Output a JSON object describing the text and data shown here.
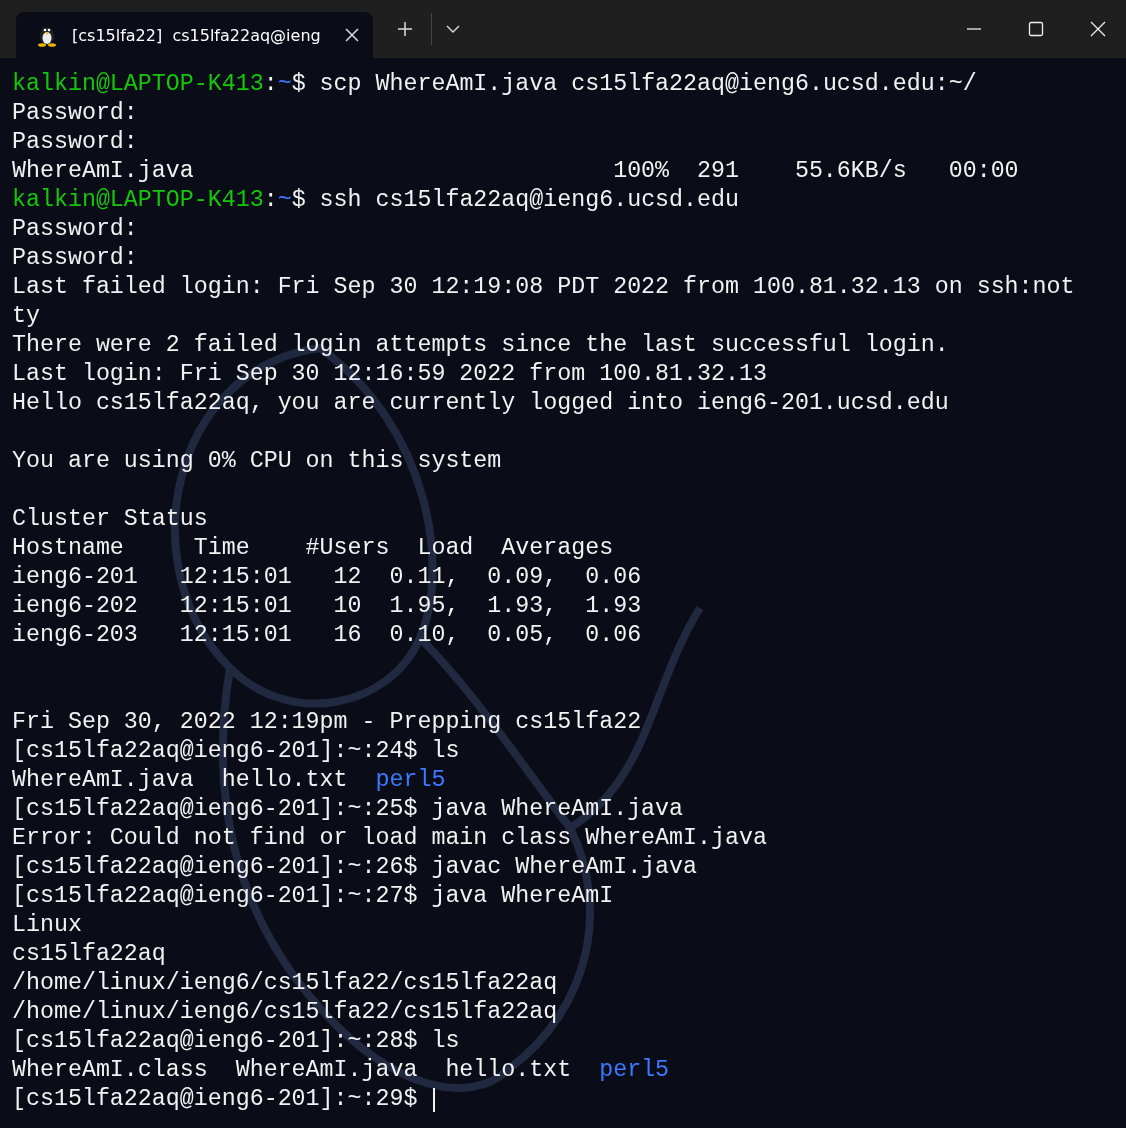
{
  "window": {
    "tabs": [
      {
        "title": "[cs15lfa22]  cs15lfa22aq@ieng",
        "selected": true
      }
    ]
  },
  "terminal": {
    "lines": [
      {
        "kind": "text",
        "segments": [
          {
            "kind": "user",
            "text": "kalkin@LAPTOP-K413"
          },
          {
            "kind": "plain",
            "text": ":"
          },
          {
            "kind": "path",
            "text": "~"
          },
          {
            "kind": "plain",
            "text": "$ scp WhereAmI.java cs15lfa22aq@ieng6.ucsd.edu:~/"
          }
        ]
      },
      {
        "kind": "text",
        "segments": [
          {
            "kind": "plain",
            "text": "Password:"
          }
        ]
      },
      {
        "kind": "text",
        "segments": [
          {
            "kind": "plain",
            "text": "Password:"
          }
        ]
      },
      {
        "kind": "text",
        "segments": [
          {
            "kind": "plain",
            "text": "WhereAmI.java                              100%  291    55.6KB/s   00:00"
          }
        ]
      },
      {
        "kind": "text",
        "segments": [
          {
            "kind": "user",
            "text": "kalkin@LAPTOP-K413"
          },
          {
            "kind": "plain",
            "text": ":"
          },
          {
            "kind": "path",
            "text": "~"
          },
          {
            "kind": "plain",
            "text": "$ ssh cs15lfa22aq@ieng6.ucsd.edu"
          }
        ]
      },
      {
        "kind": "text",
        "segments": [
          {
            "kind": "plain",
            "text": "Password:"
          }
        ]
      },
      {
        "kind": "text",
        "segments": [
          {
            "kind": "plain",
            "text": "Password:"
          }
        ]
      },
      {
        "kind": "text",
        "segments": [
          {
            "kind": "plain",
            "text": "Last failed login: Fri Sep 30 12:19:08 PDT 2022 from 100.81.32.13 on ssh:not"
          }
        ]
      },
      {
        "kind": "text",
        "segments": [
          {
            "kind": "plain",
            "text": "ty"
          }
        ]
      },
      {
        "kind": "text",
        "segments": [
          {
            "kind": "plain",
            "text": "There were 2 failed login attempts since the last successful login."
          }
        ]
      },
      {
        "kind": "text",
        "segments": [
          {
            "kind": "plain",
            "text": "Last login: Fri Sep 30 12:16:59 2022 from 100.81.32.13"
          }
        ]
      },
      {
        "kind": "text",
        "segments": [
          {
            "kind": "plain",
            "text": "Hello cs15lfa22aq, you are currently logged into ieng6-201.ucsd.edu"
          }
        ]
      },
      {
        "kind": "blank"
      },
      {
        "kind": "text",
        "segments": [
          {
            "kind": "plain",
            "text": "You are using 0% CPU on this system"
          }
        ]
      },
      {
        "kind": "blank"
      },
      {
        "kind": "text",
        "segments": [
          {
            "kind": "plain",
            "text": "Cluster Status"
          }
        ]
      },
      {
        "kind": "text",
        "segments": [
          {
            "kind": "plain",
            "text": "Hostname     Time    #Users  Load  Averages"
          }
        ]
      },
      {
        "kind": "text",
        "segments": [
          {
            "kind": "plain",
            "text": "ieng6-201   12:15:01   12  0.11,  0.09,  0.06"
          }
        ]
      },
      {
        "kind": "text",
        "segments": [
          {
            "kind": "plain",
            "text": "ieng6-202   12:15:01   10  1.95,  1.93,  1.93"
          }
        ]
      },
      {
        "kind": "text",
        "segments": [
          {
            "kind": "plain",
            "text": "ieng6-203   12:15:01   16  0.10,  0.05,  0.06"
          }
        ]
      },
      {
        "kind": "blank"
      },
      {
        "kind": "blank"
      },
      {
        "kind": "text",
        "segments": [
          {
            "kind": "plain",
            "text": "Fri Sep 30, 2022 12:19pm - Prepping cs15lfa22"
          }
        ]
      },
      {
        "kind": "text",
        "segments": [
          {
            "kind": "plain",
            "text": "[cs15lfa22aq@ieng6-201]:~:24$ ls"
          }
        ]
      },
      {
        "kind": "text",
        "segments": [
          {
            "kind": "plain",
            "text": "WhereAmI.java  hello.txt  "
          },
          {
            "kind": "dir",
            "text": "perl5"
          }
        ]
      },
      {
        "kind": "text",
        "segments": [
          {
            "kind": "plain",
            "text": "[cs15lfa22aq@ieng6-201]:~:25$ java WhereAmI.java"
          }
        ]
      },
      {
        "kind": "text",
        "segments": [
          {
            "kind": "plain",
            "text": "Error: Could not find or load main class WhereAmI.java"
          }
        ]
      },
      {
        "kind": "text",
        "segments": [
          {
            "kind": "plain",
            "text": "[cs15lfa22aq@ieng6-201]:~:26$ javac WhereAmI.java"
          }
        ]
      },
      {
        "kind": "text",
        "segments": [
          {
            "kind": "plain",
            "text": "[cs15lfa22aq@ieng6-201]:~:27$ java WhereAmI"
          }
        ]
      },
      {
        "kind": "text",
        "segments": [
          {
            "kind": "plain",
            "text": "Linux"
          }
        ]
      },
      {
        "kind": "text",
        "segments": [
          {
            "kind": "plain",
            "text": "cs15lfa22aq"
          }
        ]
      },
      {
        "kind": "text",
        "segments": [
          {
            "kind": "plain",
            "text": "/home/linux/ieng6/cs15lfa22/cs15lfa22aq"
          }
        ]
      },
      {
        "kind": "text",
        "segments": [
          {
            "kind": "plain",
            "text": "/home/linux/ieng6/cs15lfa22/cs15lfa22aq"
          }
        ]
      },
      {
        "kind": "text",
        "segments": [
          {
            "kind": "plain",
            "text": "[cs15lfa22aq@ieng6-201]:~:28$ ls"
          }
        ]
      },
      {
        "kind": "text",
        "segments": [
          {
            "kind": "plain",
            "text": "WhereAmI.class  WhereAmI.java  hello.txt  "
          },
          {
            "kind": "dir",
            "text": "perl5"
          }
        ]
      },
      {
        "kind": "text",
        "cursor": true,
        "segments": [
          {
            "kind": "plain",
            "text": "[cs15lfa22aq@ieng6-201]:~:29$ "
          }
        ]
      }
    ]
  }
}
